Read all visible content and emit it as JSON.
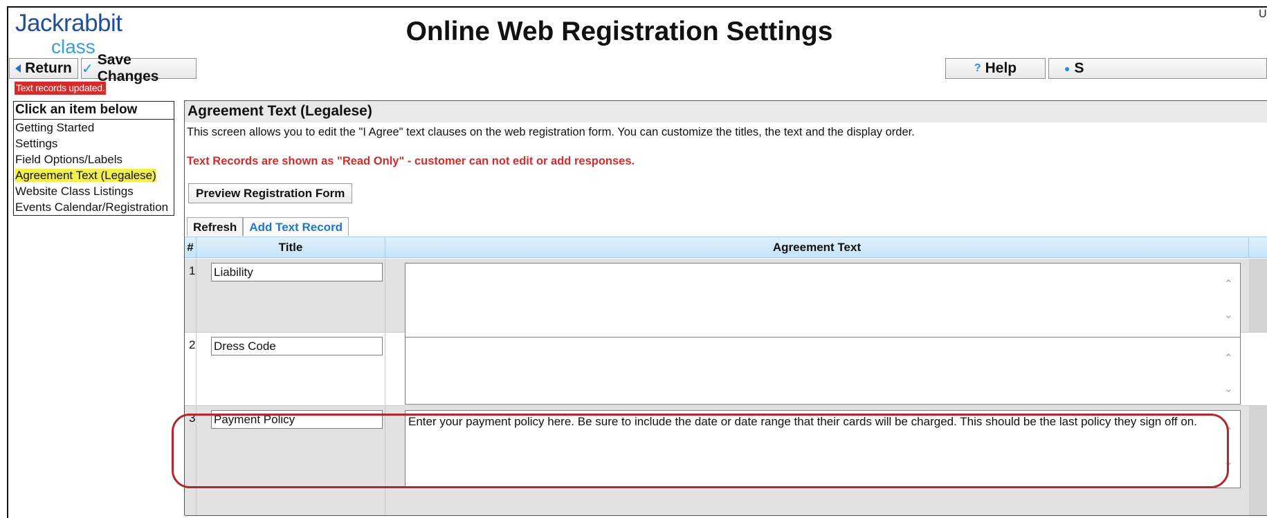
{
  "logo": {
    "line1": "Jackrabbit",
    "line2": "class"
  },
  "page_title": "Online Web Registration Settings",
  "corner_text": "U",
  "toolbar": {
    "return_label": "Return",
    "save_label": "Save Changes",
    "help_label": "Help",
    "partial_label": "S"
  },
  "status_message": "Text records updated.",
  "sidebar": {
    "header": "Click an item below",
    "items": [
      {
        "label": "Getting Started",
        "selected": false
      },
      {
        "label": "Settings",
        "selected": false
      },
      {
        "label": "Field Options/Labels",
        "selected": false
      },
      {
        "label": "Agreement Text (Legalese)",
        "selected": true
      },
      {
        "label": "Website Class Listings",
        "selected": false
      },
      {
        "label": "Events Calendar/Registration",
        "selected": false
      }
    ]
  },
  "panel": {
    "title": "Agreement Text (Legalese)",
    "description": "This screen allows you to edit the \"I Agree\" text clauses on the web registration form. You can customize the titles, the text and the display order.",
    "warning": "Text Records are shown as \"Read Only\" - customer can not edit or add responses.",
    "preview_button": "Preview Registration Form",
    "tabs": {
      "refresh": "Refresh",
      "add": "Add Text Record"
    },
    "table": {
      "headers": {
        "num": "#",
        "title": "Title",
        "text": "Agreement Text"
      },
      "rows": [
        {
          "num": "1",
          "title": "Liability",
          "text": ""
        },
        {
          "num": "2",
          "title": "Dress Code",
          "text": ""
        },
        {
          "num": "3",
          "title": "Payment Policy",
          "text": "Enter your payment policy here. Be sure to include the date or date range that their cards will be charged. This should be the last policy they sign off on."
        }
      ]
    }
  },
  "colors": {
    "brand_dark": "#1f4e9c",
    "brand_light": "#3aa0d8",
    "alert_red": "#d42b2b",
    "highlight_yellow": "#f4f04a",
    "link_blue": "#1c79c7"
  }
}
